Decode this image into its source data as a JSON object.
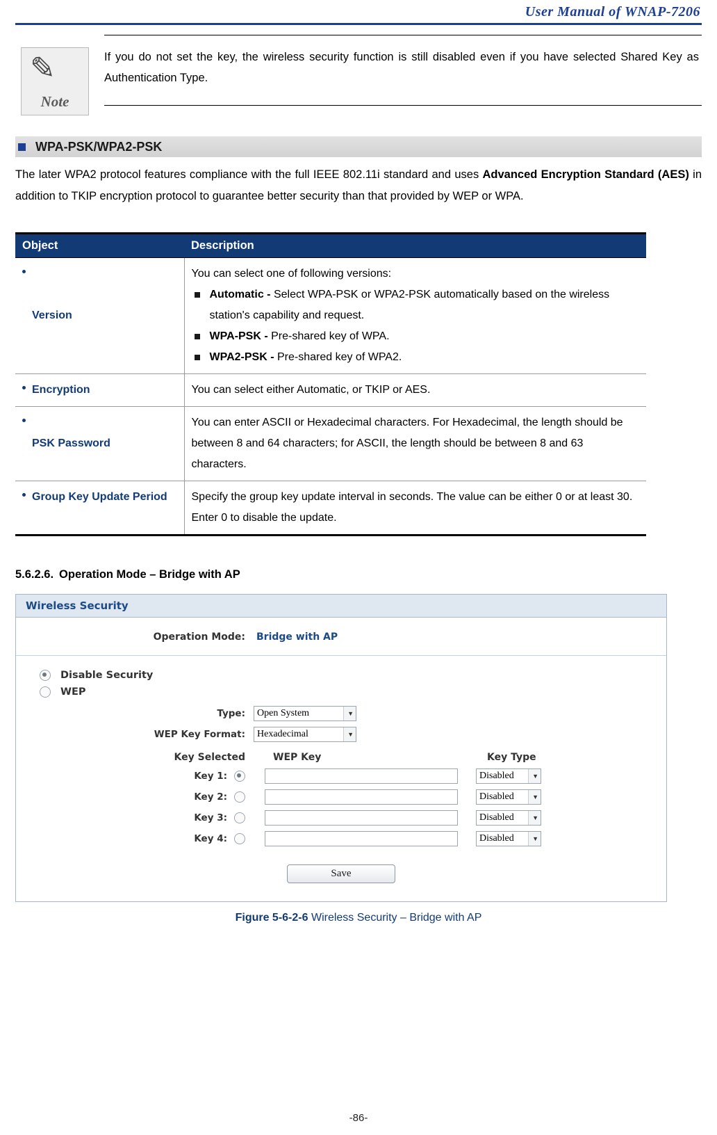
{
  "header": {
    "title": "User Manual of WNAP-7206"
  },
  "note": {
    "icon_label": "Note",
    "text": "If you do not set the key, the wireless security function is still disabled even if you have selected Shared Key as Authentication Type."
  },
  "section": {
    "heading": "WPA-PSK/WPA2-PSK",
    "paragraph_parts": {
      "p1": "The later WPA2 protocol features compliance with the full IEEE 802.11i standard and uses ",
      "b1": "Advanced Encryption Standard (AES)",
      "p2": " in addition to TKIP encryption protocol to guarantee better security than that provided by WEP or WPA."
    }
  },
  "table": {
    "headers": [
      "Object",
      "Description"
    ],
    "rows": [
      {
        "object": "Version",
        "desc_intro": "You can select one of following versions:",
        "bullets": [
          {
            "bold": "Automatic - ",
            "text": "Select WPA-PSK or WPA2-PSK automatically based on the wireless station's capability and request."
          },
          {
            "bold": "WPA-PSK - ",
            "text": "Pre-shared key of WPA."
          },
          {
            "bold": "WPA2-PSK - ",
            "text": "Pre-shared key of WPA2."
          }
        ]
      },
      {
        "object": "Encryption",
        "desc": "You can select either Automatic, or TKIP or AES."
      },
      {
        "object": "PSK Password",
        "desc": "You can enter ASCII or Hexadecimal characters. For Hexadecimal, the length should be between 8 and 64 characters; for ASCII, the length should be between 8 and 63 characters."
      },
      {
        "object": "Group Key Update Period",
        "desc": "Specify the group key update interval in seconds. The value can be either 0 or at least 30. Enter 0 to disable the update."
      }
    ]
  },
  "subheading": {
    "number": "5.6.2.6.",
    "text": "Operation Mode – Bridge with AP"
  },
  "screenshot": {
    "panel_title": "Wireless Security",
    "operation_mode_label": "Operation Mode:",
    "operation_mode_value": "Bridge with AP",
    "disable_security_label": "Disable Security",
    "wep_label": "WEP",
    "type_label": "Type:",
    "type_value": "Open System",
    "wep_key_format_label": "WEP Key Format:",
    "wep_key_format_value": "Hexadecimal",
    "col_key_selected": "Key Selected",
    "col_wep_key": "WEP Key",
    "col_key_type": "Key Type",
    "keys": [
      {
        "label": "Key 1:",
        "value": "",
        "type": "Disabled",
        "selected": true
      },
      {
        "label": "Key 2:",
        "value": "",
        "type": "Disabled",
        "selected": false
      },
      {
        "label": "Key 3:",
        "value": "",
        "type": "Disabled",
        "selected": false
      },
      {
        "label": "Key 4:",
        "value": "",
        "type": "Disabled",
        "selected": false
      }
    ],
    "save_label": "Save"
  },
  "figure": {
    "label": "Figure 5-6-2-6",
    "caption": " Wireless Security – Bridge with AP"
  },
  "footer": {
    "page": "-86-"
  }
}
